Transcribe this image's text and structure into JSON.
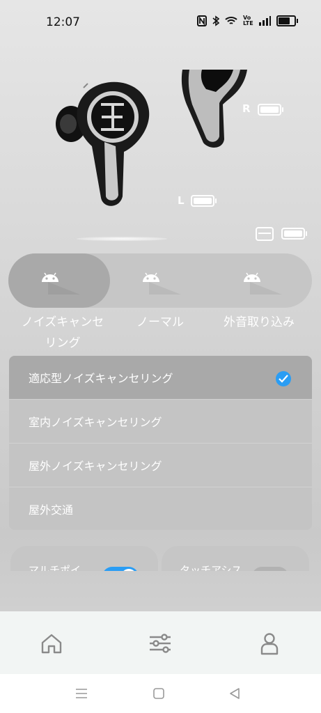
{
  "status_bar": {
    "time": "12:07",
    "icons": [
      "nfc-icon",
      "bluetooth-icon",
      "wifi-icon",
      "volte-icon",
      "signal-icon",
      "battery-icon"
    ],
    "volte_text": "Vo LTE",
    "battery_level": 0.85
  },
  "earbuds": {
    "right_label": "R",
    "left_label": "L",
    "right_battery": 1.0,
    "left_battery": 1.0,
    "case_battery": 1.0,
    "brand_color": "#1a1a1a"
  },
  "modes": {
    "selected": 0,
    "items": [
      {
        "label": "ノイズキャンセリング",
        "label_line1": "ノイズキャンセ",
        "label_line2": "リング",
        "icon": "android-icon"
      },
      {
        "label": "ノーマル",
        "icon": "android-icon"
      },
      {
        "label": "外音取り込み",
        "icon": "android-icon"
      }
    ]
  },
  "anc_options": {
    "selected": 0,
    "items": [
      {
        "label": "適応型ノイズキャンセリング"
      },
      {
        "label": "室内ノイズキャンセリング"
      },
      {
        "label": "屋外ノイズキャンセリング"
      },
      {
        "label": "屋外交通"
      }
    ],
    "check_color": "#2a9df4"
  },
  "feature_cards": [
    {
      "label": "マルチポイ",
      "toggle_on": true
    },
    {
      "label": "タッチアシス",
      "toggle_on": false
    }
  ],
  "bottom_nav": {
    "items": [
      {
        "icon": "home-icon"
      },
      {
        "icon": "equalizer-icon"
      },
      {
        "icon": "profile-icon"
      }
    ]
  },
  "system_nav": {
    "items": [
      {
        "icon": "menu-icon"
      },
      {
        "icon": "home-square-icon"
      },
      {
        "icon": "back-triangle-icon"
      }
    ]
  }
}
